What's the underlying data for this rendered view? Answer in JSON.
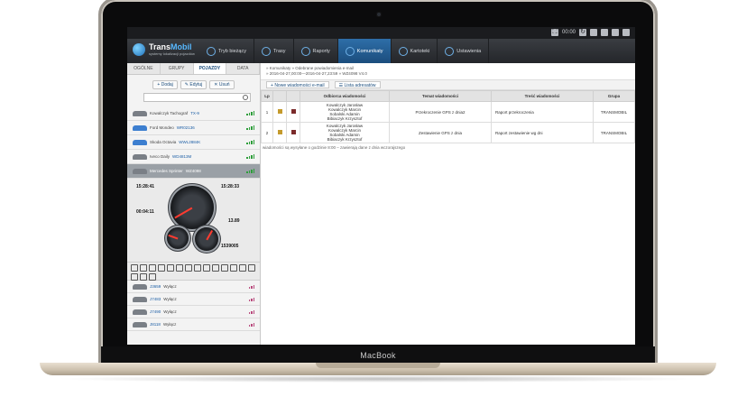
{
  "device": {
    "brand": "MacBook"
  },
  "systembar": {
    "clock": "00:00"
  },
  "app": {
    "logo_name_1": "Trans",
    "logo_name_2": "Mobil",
    "logo_tagline": "systemy lokalizacji pojazdów",
    "nav": [
      {
        "label": "Tryb bieżący"
      },
      {
        "label": "Trasy"
      },
      {
        "label": "Raporty"
      },
      {
        "label": "Komunikaty",
        "active": true
      },
      {
        "label": "Kartoteki"
      },
      {
        "label": "Ustawienia"
      }
    ]
  },
  "left": {
    "tabs": [
      "OGÓLNE",
      "GRUPY",
      "POJAZDY",
      "DATA"
    ],
    "actions": {
      "add": "Dodaj",
      "edit": "Edytuj",
      "delete": "Usuń"
    },
    "vehicles": [
      {
        "name": "Kowalczyk Tachograf",
        "plate": "TX-9"
      },
      {
        "name": "Ford Mondeo",
        "plate": "WR02136"
      },
      {
        "name": "Skoda Octavia",
        "plate": "WWL2884K"
      },
      {
        "name": "Iveco Daily",
        "plate": "WD4813M"
      },
      {
        "name": "Mercedes Sprinter",
        "plate": "WZ4098"
      }
    ],
    "dashboard": {
      "left_top_value": "15:28:41",
      "right_top_value": "15:28:33",
      "left_mid_value": "00:04:11",
      "right_mid_value": "13.89",
      "right_bottom_value": "1539005"
    },
    "parked": [
      {
        "plate": "J3659",
        "state": "Wyłącz"
      },
      {
        "plate": "J7483",
        "state": "Wyłącz"
      },
      {
        "plate": "J7490",
        "state": "Wyłącz"
      },
      {
        "plate": "J8118",
        "state": "Wyłącz"
      }
    ]
  },
  "main": {
    "breadcrumb_1": "» Komunikaty » Odebrane powiadomienia e-mail",
    "breadcrumb_2": "» 2016-04-27,00:00—2016-04-27,23:59 » WZ4098 V4.0",
    "buttons": {
      "new_email": "Nowe wiadomości e-mail",
      "recipients": "Lista adresatów"
    },
    "table_headers": [
      "Lp",
      "",
      "",
      "Odbiorca wiadomości",
      "Temat wiadomości",
      "Treść wiadomości",
      "Grupa"
    ],
    "rows": [
      {
        "lp": "1",
        "recipients": [
          "Kowalczyk Jarosław",
          "Kowalczyk Marcin",
          "Sobalski Adamin",
          "Bibiaczyk Krzysztof"
        ],
        "subject": "Przekroczenie GPS z dnia2",
        "body": "Raport przekroczenia",
        "group": "TRANSMOBIL"
      },
      {
        "lp": "2",
        "recipients": [
          "Kowalczyk Jarosław",
          "Kowalczyk Marcin",
          "Sobalski Adamin",
          "Bibiaczyk Krzysztof"
        ],
        "subject": "Zestawienie GPS z dnia",
        "body": "Raport zestawienie wg dni",
        "group": "TRANSMOBIL"
      }
    ],
    "note": "wiadomości są wysyłane o godzinie 8:00 – zawierają dane z dnia wczorajszego"
  }
}
